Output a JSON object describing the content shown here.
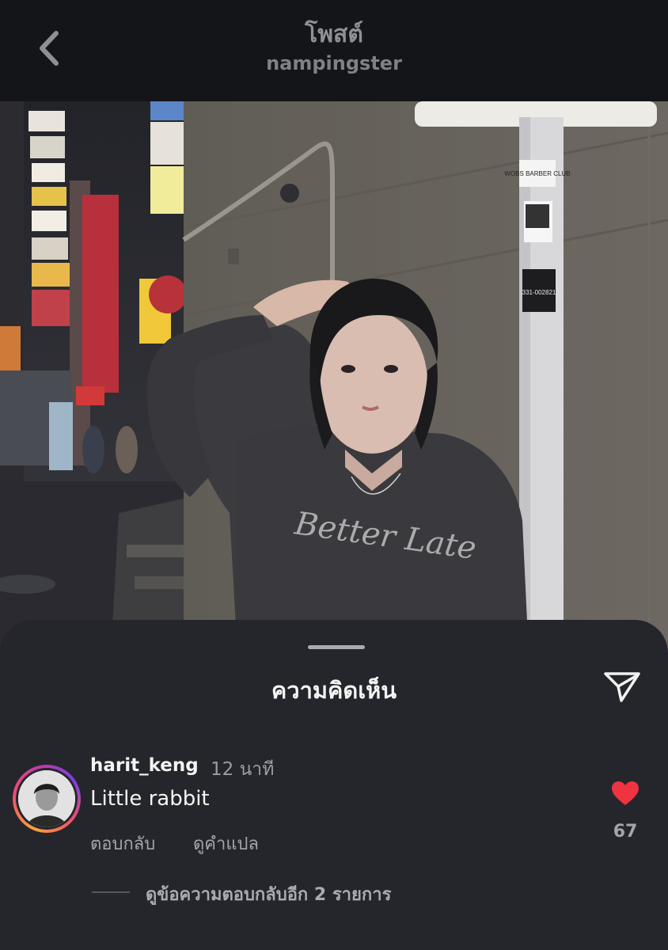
{
  "header": {
    "title": "โพสต์",
    "username": "nampingster"
  },
  "comments_sheet": {
    "title": "ความคิดเห็น"
  },
  "comment": {
    "username": "harit_keng",
    "time": "12 นาที",
    "text": "Little rabbit",
    "reply_label": "ตอบกลับ",
    "translate_label": "ดูคำแปล",
    "like_count": "67",
    "view_replies_label": "ดูข้อความตอบกลับอีก 2 รายการ"
  },
  "photo_signs": {
    "pole_sticker": "WOBS BARBER CLUB",
    "pole_label": "331-002821"
  },
  "colors": {
    "background": "#141518",
    "sheet": "#25262b",
    "like": "#ef3340"
  }
}
